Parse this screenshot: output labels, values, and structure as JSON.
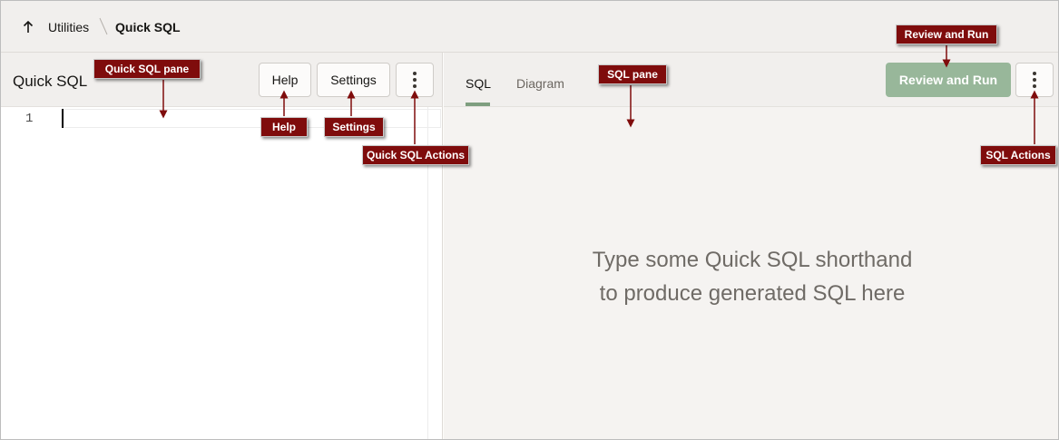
{
  "breadcrumb": {
    "parent": "Utilities",
    "current": "Quick SQL"
  },
  "left_pane": {
    "title": "Quick SQL",
    "help_label": "Help",
    "settings_label": "Settings",
    "editor": {
      "line_numbers": [
        "1"
      ],
      "content": ""
    }
  },
  "right_pane": {
    "tabs": [
      {
        "label": "SQL",
        "active": true
      },
      {
        "label": "Diagram",
        "active": false
      }
    ],
    "review_run_label": "Review and Run",
    "empty_message_line1": "Type some Quick SQL shorthand",
    "empty_message_line2": "to produce generated SQL here"
  },
  "callouts": {
    "quick_sql_pane": "Quick SQL pane",
    "help": "Help",
    "settings": "Settings",
    "quick_sql_actions": "Quick SQL Actions",
    "sql_pane": "SQL pane",
    "review_and_run": "Review and Run",
    "sql_actions": "SQL Actions"
  },
  "colors": {
    "callout_bg": "#7f0c0c",
    "review_button": "#98b79a",
    "tab_underline": "#7e9e7f"
  },
  "icons": [
    "up-arrow-icon",
    "kebab-menu-icon"
  ]
}
